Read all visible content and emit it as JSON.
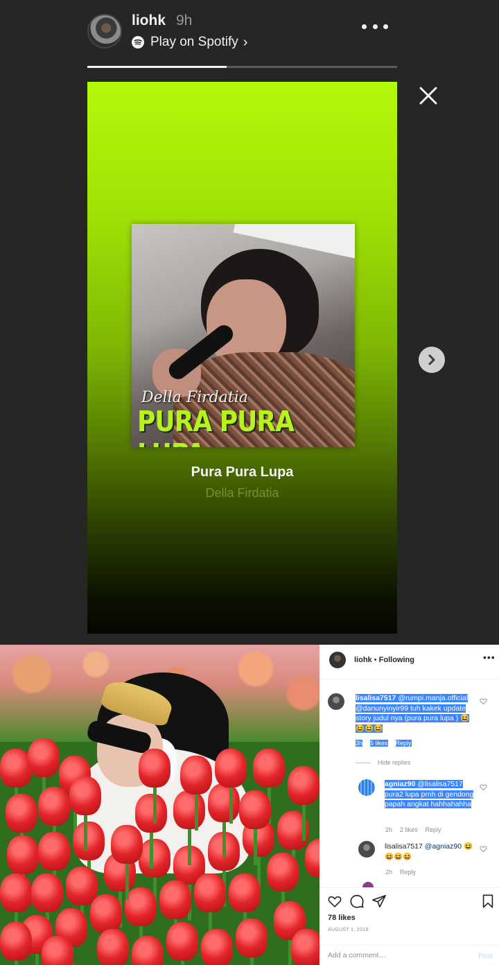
{
  "story": {
    "username": "liohk",
    "time": "9h",
    "spotify_label": "Play on Spotify",
    "chevron": "›",
    "progress": 0.45,
    "track": {
      "album_artist_text": "Della Firdatia",
      "album_title_text": "PURA PURA LUPA",
      "title": "Pura Pura Lupa",
      "artist": "Della Firdatia"
    },
    "colors": {
      "card_top": "#b3f90a",
      "card_bottom": "#060800",
      "background": "#262626"
    },
    "icons": {
      "menu": "more-horizontal-icon",
      "close": "close-icon",
      "next": "chevron-right-icon",
      "spotify": "spotify-icon"
    }
  },
  "post": {
    "header": {
      "username": "liohk",
      "separator": " • ",
      "follow_state": "Following",
      "more": "•••"
    },
    "comments": [
      {
        "username": "lisalisa7517",
        "text": "@rumpi.manja.official @danunyinyir99 tuh kakek update story judul nya (pura pura lupa ) 😆😆😆😆",
        "time": "3h",
        "likes": "5 likes",
        "reply": "Reply",
        "highlighted": true
      }
    ],
    "hide_replies": "Hide replies",
    "replies": [
      {
        "username": "agniaz90",
        "text": "@lisalisa7517 pura2 lupa prnh di gendong papah angkat hahhahahha",
        "time": "2h",
        "likes": "2 likes",
        "reply": "Reply",
        "highlighted": true
      },
      {
        "username": "lisalisa7517",
        "text": "@agniaz90 😆😆😆😆",
        "time": "2h",
        "reply": "Reply",
        "highlighted": false
      }
    ],
    "likes": "78 likes",
    "date": "AUGUST 1, 2018",
    "add_comment_placeholder": "Add a comment…",
    "post_label": "Post",
    "colors": {
      "highlight": "#3a86ff",
      "link_blue": "#b2dffc",
      "muted": "#8e8e8e"
    }
  }
}
